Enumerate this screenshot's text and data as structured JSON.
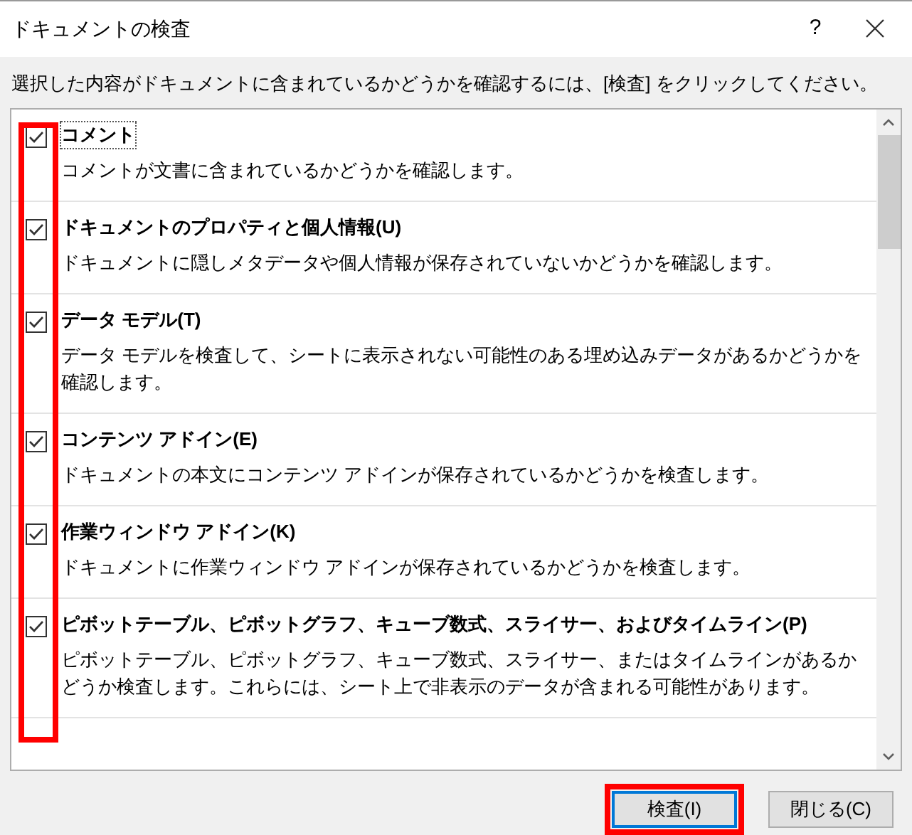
{
  "window": {
    "title": "ドキュメントの検査",
    "help": "?"
  },
  "instruction": "選択した内容がドキュメントに含まれているかどうかを確認するには、[検査] をクリックしてください。",
  "items": [
    {
      "label": "コメント",
      "description": "コメントが文書に含まれているかどうかを確認します。",
      "checked": true,
      "focused": true
    },
    {
      "label": "ドキュメントのプロパティと個人情報(U)",
      "description": "ドキュメントに隠しメタデータや個人情報が保存されていないかどうかを確認します。",
      "checked": true,
      "focused": false
    },
    {
      "label": "データ モデル(T)",
      "description": "データ モデルを検査して、シートに表示されない可能性のある埋め込みデータがあるかどうかを確認します。",
      "checked": true,
      "focused": false
    },
    {
      "label": "コンテンツ アドイン(E)",
      "description": "ドキュメントの本文にコンテンツ アドインが保存されているかどうかを検査します。",
      "checked": true,
      "focused": false
    },
    {
      "label": "作業ウィンドウ アドイン(K)",
      "description": "ドキュメントに作業ウィンドウ アドインが保存されているかどうかを検査します。",
      "checked": true,
      "focused": false
    },
    {
      "label": "ピボットテーブル、ピボットグラフ、キューブ数式、スライサー、およびタイムライン(P)",
      "description": "ピボットテーブル、ピボットグラフ、キューブ数式、スライサー、またはタイムラインがあるかどうか検査します。これらには、シート上で非表示のデータが含まれる可能性があります。",
      "checked": true,
      "focused": false
    }
  ],
  "buttons": [
    {
      "label": "検査(I)",
      "default": true,
      "highlighted": true
    },
    {
      "label": "閉じる(C)",
      "default": false,
      "highlighted": false
    }
  ]
}
